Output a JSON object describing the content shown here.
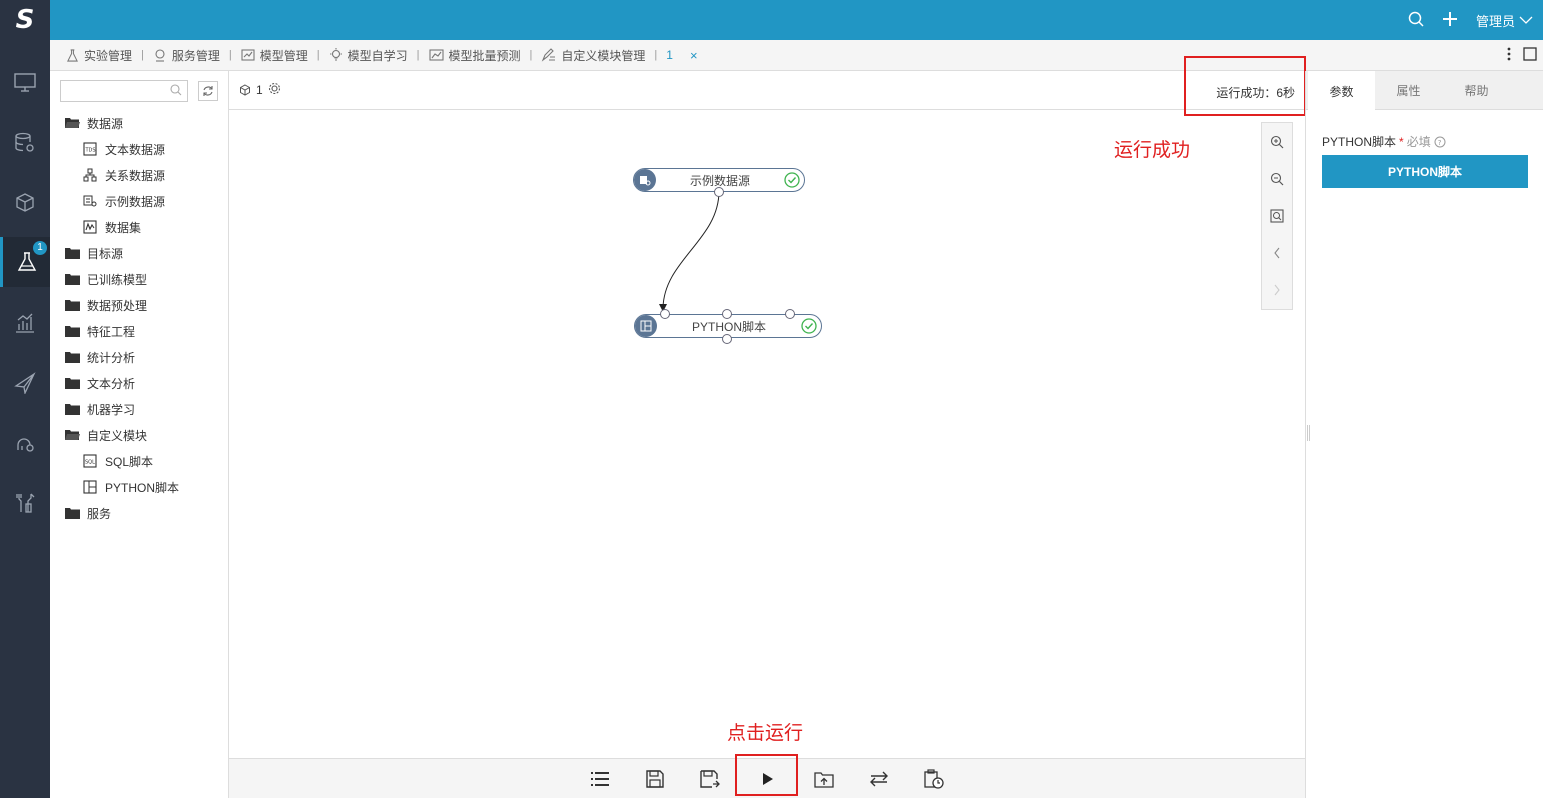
{
  "header": {
    "user_label": "管理员"
  },
  "rail": {
    "badge_count": "1"
  },
  "tabs": {
    "items": [
      {
        "label": "实验管理"
      },
      {
        "label": "服务管理"
      },
      {
        "label": "模型管理"
      },
      {
        "label": "模型自学习"
      },
      {
        "label": "模型批量预测"
      },
      {
        "label": "自定义模块管理"
      }
    ],
    "current_label": "1"
  },
  "tree": {
    "search_placeholder": "",
    "items": [
      {
        "label": "数据源"
      },
      {
        "label": "文本数据源"
      },
      {
        "label": "关系数据源"
      },
      {
        "label": "示例数据源"
      },
      {
        "label": "数据集"
      },
      {
        "label": "目标源"
      },
      {
        "label": "已训练模型"
      },
      {
        "label": "数据预处理"
      },
      {
        "label": "特征工程"
      },
      {
        "label": "统计分析"
      },
      {
        "label": "文本分析"
      },
      {
        "label": "机器学习"
      },
      {
        "label": "自定义模块"
      },
      {
        "label": "SQL脚本"
      },
      {
        "label": "PYTHON脚本"
      },
      {
        "label": "服务"
      }
    ]
  },
  "canvas": {
    "experiment_id": "1",
    "run_status": "运行成功：6秒",
    "annotation_success": "运行成功",
    "annotation_run": "点击运行",
    "nodes": [
      {
        "label": "示例数据源"
      },
      {
        "label": "PYTHON脚本"
      }
    ]
  },
  "right_panel": {
    "tabs": [
      "参数",
      "属性",
      "帮助"
    ],
    "param_label": "PYTHON脚本",
    "required_mark": "*",
    "required_text": "必填",
    "button_label": "PYTHON脚本"
  },
  "colors": {
    "topbar": "#2196c4",
    "rail": "#2a3342",
    "annotation": "#e02020",
    "node_border": "#5b7594",
    "success": "#3fb34f"
  }
}
